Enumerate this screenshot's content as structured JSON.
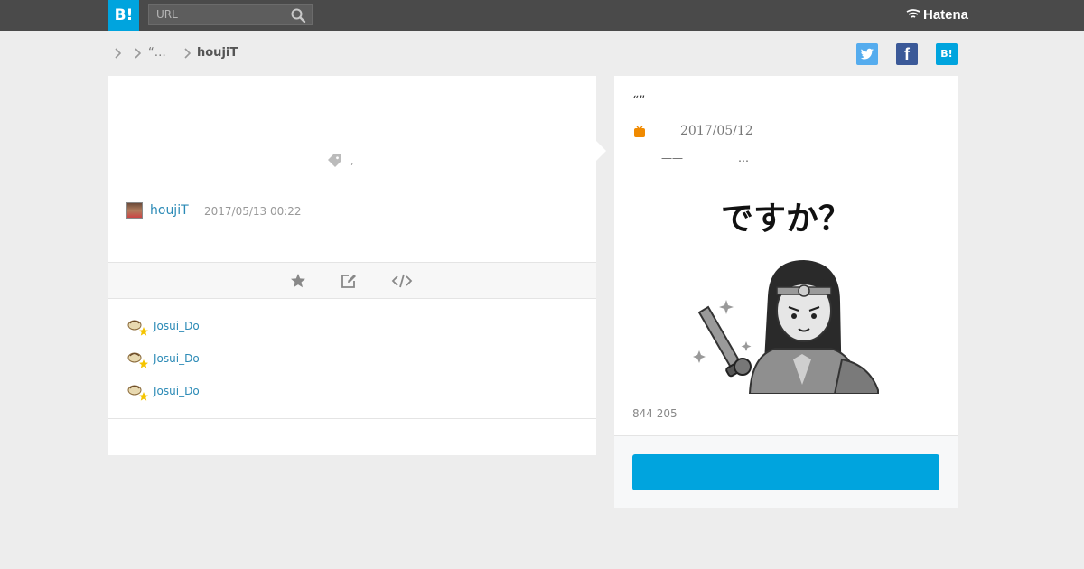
{
  "header": {
    "logo_text": "B!",
    "search_placeholder": "URL",
    "brand": "Hatena"
  },
  "breadcrumb": {
    "items": [
      "",
      "“…",
      "houjiT"
    ]
  },
  "share": {
    "twitter_icon": "twitter-icon",
    "facebook_label": "f",
    "hatebu_label": "B!"
  },
  "comment": {
    "tag_text": ",",
    "username": "houjiT",
    "datetime": "2017/05/13 00:22"
  },
  "stars": [
    {
      "name": "Josui_Do"
    },
    {
      "name": "Josui_Do"
    },
    {
      "name": "Josui_Do"
    }
  ],
  "entry": {
    "title": "“”",
    "date": "2017/05/12",
    "description": "——                …",
    "image_caption": "ですか？",
    "count": "844 205",
    "button_label": ""
  },
  "colors": {
    "brand": "#00a4de",
    "header": "#4a4a4a",
    "link": "#2b8ab6"
  }
}
